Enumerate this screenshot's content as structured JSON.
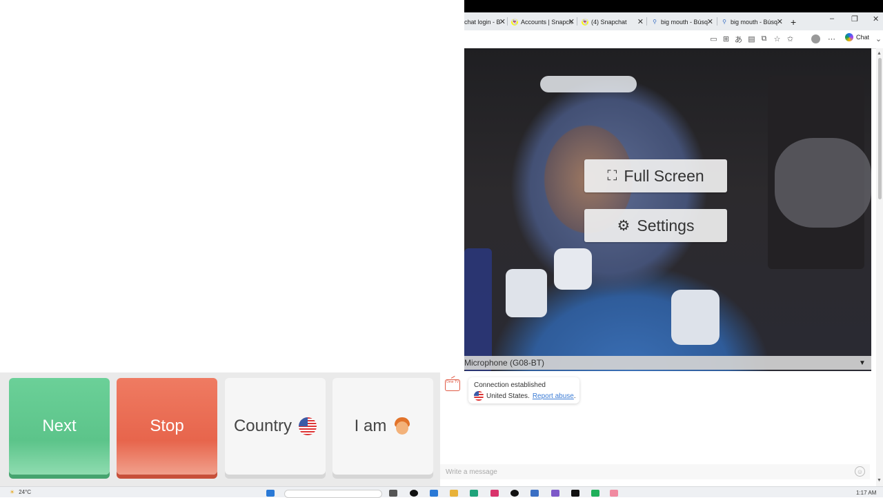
{
  "browser": {
    "tabs": [
      {
        "label": "chat login - B",
        "icon": "search-icon"
      },
      {
        "label": "Accounts | Snapch",
        "icon": "snapchat-icon"
      },
      {
        "label": "(4) Snapchat",
        "icon": "snapchat-icon"
      },
      {
        "label": "big mouth - Búsq",
        "icon": "search-icon"
      },
      {
        "label": "big mouth - Búsq",
        "icon": "search-icon"
      }
    ],
    "new_tab": "+",
    "chat_label": "Chat"
  },
  "video": {
    "fullscreen_label": "Full Screen",
    "settings_label": "Settings",
    "microphone_label": "Microphone (G08-BT)"
  },
  "controls": {
    "next_label": "Next",
    "stop_label": "Stop",
    "country_label": "Country",
    "iam_label": "I am"
  },
  "chat": {
    "status": "Connection established",
    "country": "United States.",
    "report_link": "Report abuse",
    "report_suffix": ".",
    "logo_text": "Ome TV",
    "input_placeholder": "Write a message"
  },
  "taskbar": {
    "temperature": "24°C",
    "time": "1:17 AM"
  },
  "colors": {
    "next": "#5cc48a",
    "stop": "#e7654c",
    "link": "#3a7bd5"
  }
}
